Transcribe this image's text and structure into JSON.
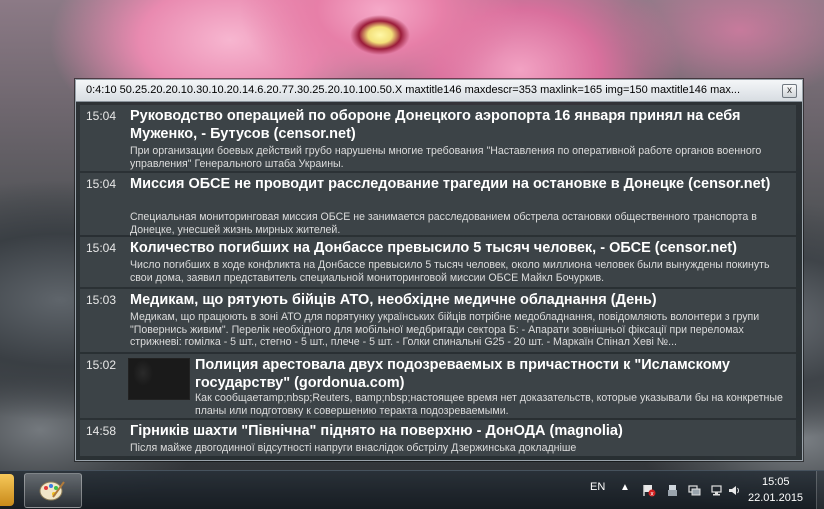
{
  "window": {
    "title": "0:4:10 50.25.20.20.10.30.10.20.14.6.20.77.30.25.20.10.100.50.X maxtitle146 maxdescr=353 maxlink=165 img=150 maxtitle146 max...",
    "close_label": "x"
  },
  "news": [
    {
      "time": "15:04",
      "title": "Руководство операцией по обороне Донецкого аэропорта 16 января принял на себя Муженко, - Бутусов (censor.net)",
      "description": "При организации боевых действий грубо нарушены многие требования \"Наставления по оперативной работе органов военного управления\" Генерального штаба Украины."
    },
    {
      "time": "15:04",
      "title": "Миссия ОБСЕ не проводит расследование трагедии на остановке в Донецке (censor.net)",
      "description": "Специальная мониторинговая миссия ОБСЕ не занимается расследованием обстрела остановки общественного транспорта в Донецке, унесшей жизнь мирных жителей."
    },
    {
      "time": "15:04",
      "title": "Количество погибших на Донбассе превысило 5 тысяч человек, - ОБСЕ (censor.net)",
      "description": "Число погибших в ходе конфликта на Донбассе превысило 5 тысяч человек, около миллиона человек были вынуждены покинуть свои дома, заявил представитель специальной мониторинговой миссии ОБСЕ Майкл Бочуркив."
    },
    {
      "time": "15:03",
      "title": "Медикам, що рятують бійців АТО, необхідне медичне обладнання (День)",
      "description": "Медикам, що працюють в зоні АТО для порятунку українських бійців потрібне медобладнання, повідомляють волонтери з групи \"Повернись живим\". Перелік необхідного для мобільної медбригади сектора Б: - Апарати зовнішньої фіксації при переломах стрижневі: гомілка - 5 шт., стегно - 5 шт., плече - 5 шт. - Голки спинальні G25 - 20 шт. - Маркаїн Спінал Хеві №..."
    },
    {
      "time": "15:02",
      "title": "Полиция арестовала двух подозреваемых в причастности к \"Исламскому государству\" (gordonua.com)",
      "description": "Как сообщаетamp;nbsp;Reuters, вamp;nbsp;настоящее время нет доказательств, которые указывали бы на конкретные планы или подготовку к совершению теракта подозреваемыми."
    },
    {
      "time": "14:58",
      "title": "Гірників шахти \"Північна\" піднято на поверхню - ДонОДА (magnolia)",
      "description": "Після майже двогодинної відсутності напруги внаслідок обстрілу Дзержинська докладніше"
    }
  ],
  "taskbar": {
    "language": "EN",
    "time": "15:05",
    "date": "22.01.2015"
  }
}
